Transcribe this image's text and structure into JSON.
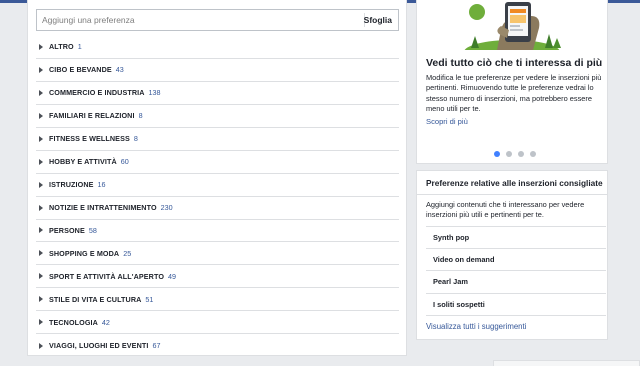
{
  "search": {
    "placeholder": "Aggiungi una preferenza",
    "browse_label": "Sfoglia"
  },
  "categories": [
    {
      "name": "ALTRO",
      "count": "1"
    },
    {
      "name": "CIBO E BEVANDE",
      "count": "43"
    },
    {
      "name": "COMMERCIO E INDUSTRIA",
      "count": "138"
    },
    {
      "name": "FAMILIARI E RELAZIONI",
      "count": "8"
    },
    {
      "name": "FITNESS E WELLNESS",
      "count": "8"
    },
    {
      "name": "HOBBY E ATTIVITÀ",
      "count": "60"
    },
    {
      "name": "ISTRUZIONE",
      "count": "16"
    },
    {
      "name": "NOTIZIE E INTRATTENIMENTO",
      "count": "230"
    },
    {
      "name": "PERSONE",
      "count": "58"
    },
    {
      "name": "SHOPPING E MODA",
      "count": "25"
    },
    {
      "name": "SPORT E ATTIVITÀ ALL'APERTO",
      "count": "49"
    },
    {
      "name": "STILE DI VITA E CULTURA",
      "count": "51"
    },
    {
      "name": "TECNOLOGIA",
      "count": "42"
    },
    {
      "name": "VIAGGI, LUOGHI ED EVENTI",
      "count": "67"
    }
  ],
  "promo": {
    "title": "Vedi tutto ciò che ti interessa di più",
    "body": "Modifica le tue preferenze per vedere le inserzioni più pertinenti. Rimuovendo tutte le preferenze vedrai lo stesso numero di inserzioni, ma potrebbero essere meno utili per te.",
    "link": "Scopri di più",
    "carousel_active_index": 0,
    "carousel_count": 4
  },
  "suggestions": {
    "title": "Preferenze relative alle inserzioni consigliate",
    "description": "Aggiungi contenuti che ti interessano per vedere inserzioni più utili e pertinenti per te.",
    "items": [
      "Synth pop",
      "Video on demand",
      "Pearl Jam",
      "I soliti sospetti"
    ],
    "view_all": "Visualizza tutti i suggerimenti"
  },
  "colors": {
    "accent_link": "#365899",
    "brand_bar": "#3b5998",
    "dot_active": "#4080ff",
    "background": "#e9ebee"
  }
}
